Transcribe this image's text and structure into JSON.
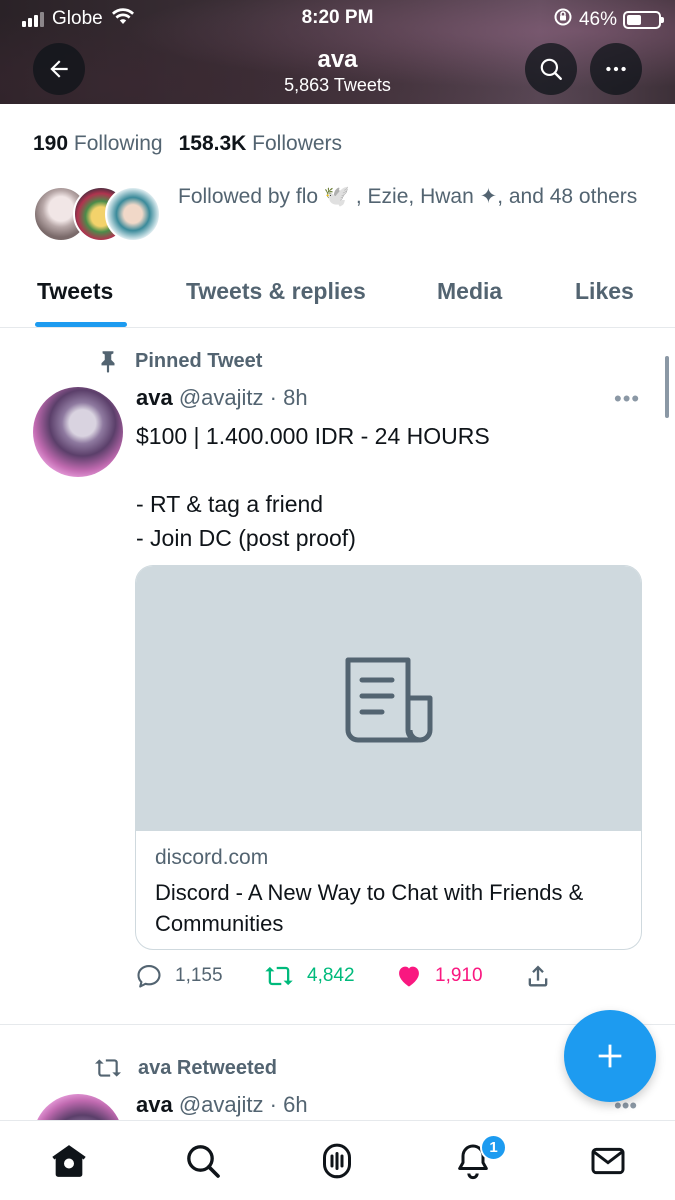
{
  "status_bar": {
    "carrier": "Globe",
    "time": "8:20 PM",
    "battery_percent": "46%",
    "battery_level": 0.46
  },
  "header": {
    "name": "ava",
    "tweet_count": "5,863 Tweets"
  },
  "profile": {
    "following_count": "190",
    "following_label": "Following",
    "followers_count": "158.3K",
    "followers_label": "Followers",
    "followed_by_text": "Followed by flo 🕊️ , Ezie, Hwan ✦, and 48 others"
  },
  "tabs": [
    {
      "label": "Tweets",
      "active": true
    },
    {
      "label": "Tweets & replies",
      "active": false
    },
    {
      "label": "Media",
      "active": false
    },
    {
      "label": "Likes",
      "active": false
    }
  ],
  "pinned_tweet": {
    "pinned_label": "Pinned Tweet",
    "display_name": "ava",
    "handle": "@avajitz",
    "time": "· 8h",
    "more": "•••",
    "text": "$100 | 1.400.000 IDR - 24 HOURS\n\n- RT & tag a friend\n- Join DC (post proof)",
    "card": {
      "domain": "discord.com",
      "title": "Discord - A New Way to Chat with Friends & Communities"
    },
    "replies": "1,155",
    "retweets": "4,842",
    "likes": "1,910"
  },
  "second_tweet": {
    "retweeted_label": "ava Retweeted",
    "display_name": "ava",
    "handle": "@avajitz",
    "time": "· 6h",
    "more": "•••"
  },
  "bottom_nav": {
    "notification_badge": "1"
  },
  "colors": {
    "accent": "#1d9bf0",
    "retweet": "#00ba7c",
    "like": "#f91880",
    "secondary_text": "#536471"
  }
}
